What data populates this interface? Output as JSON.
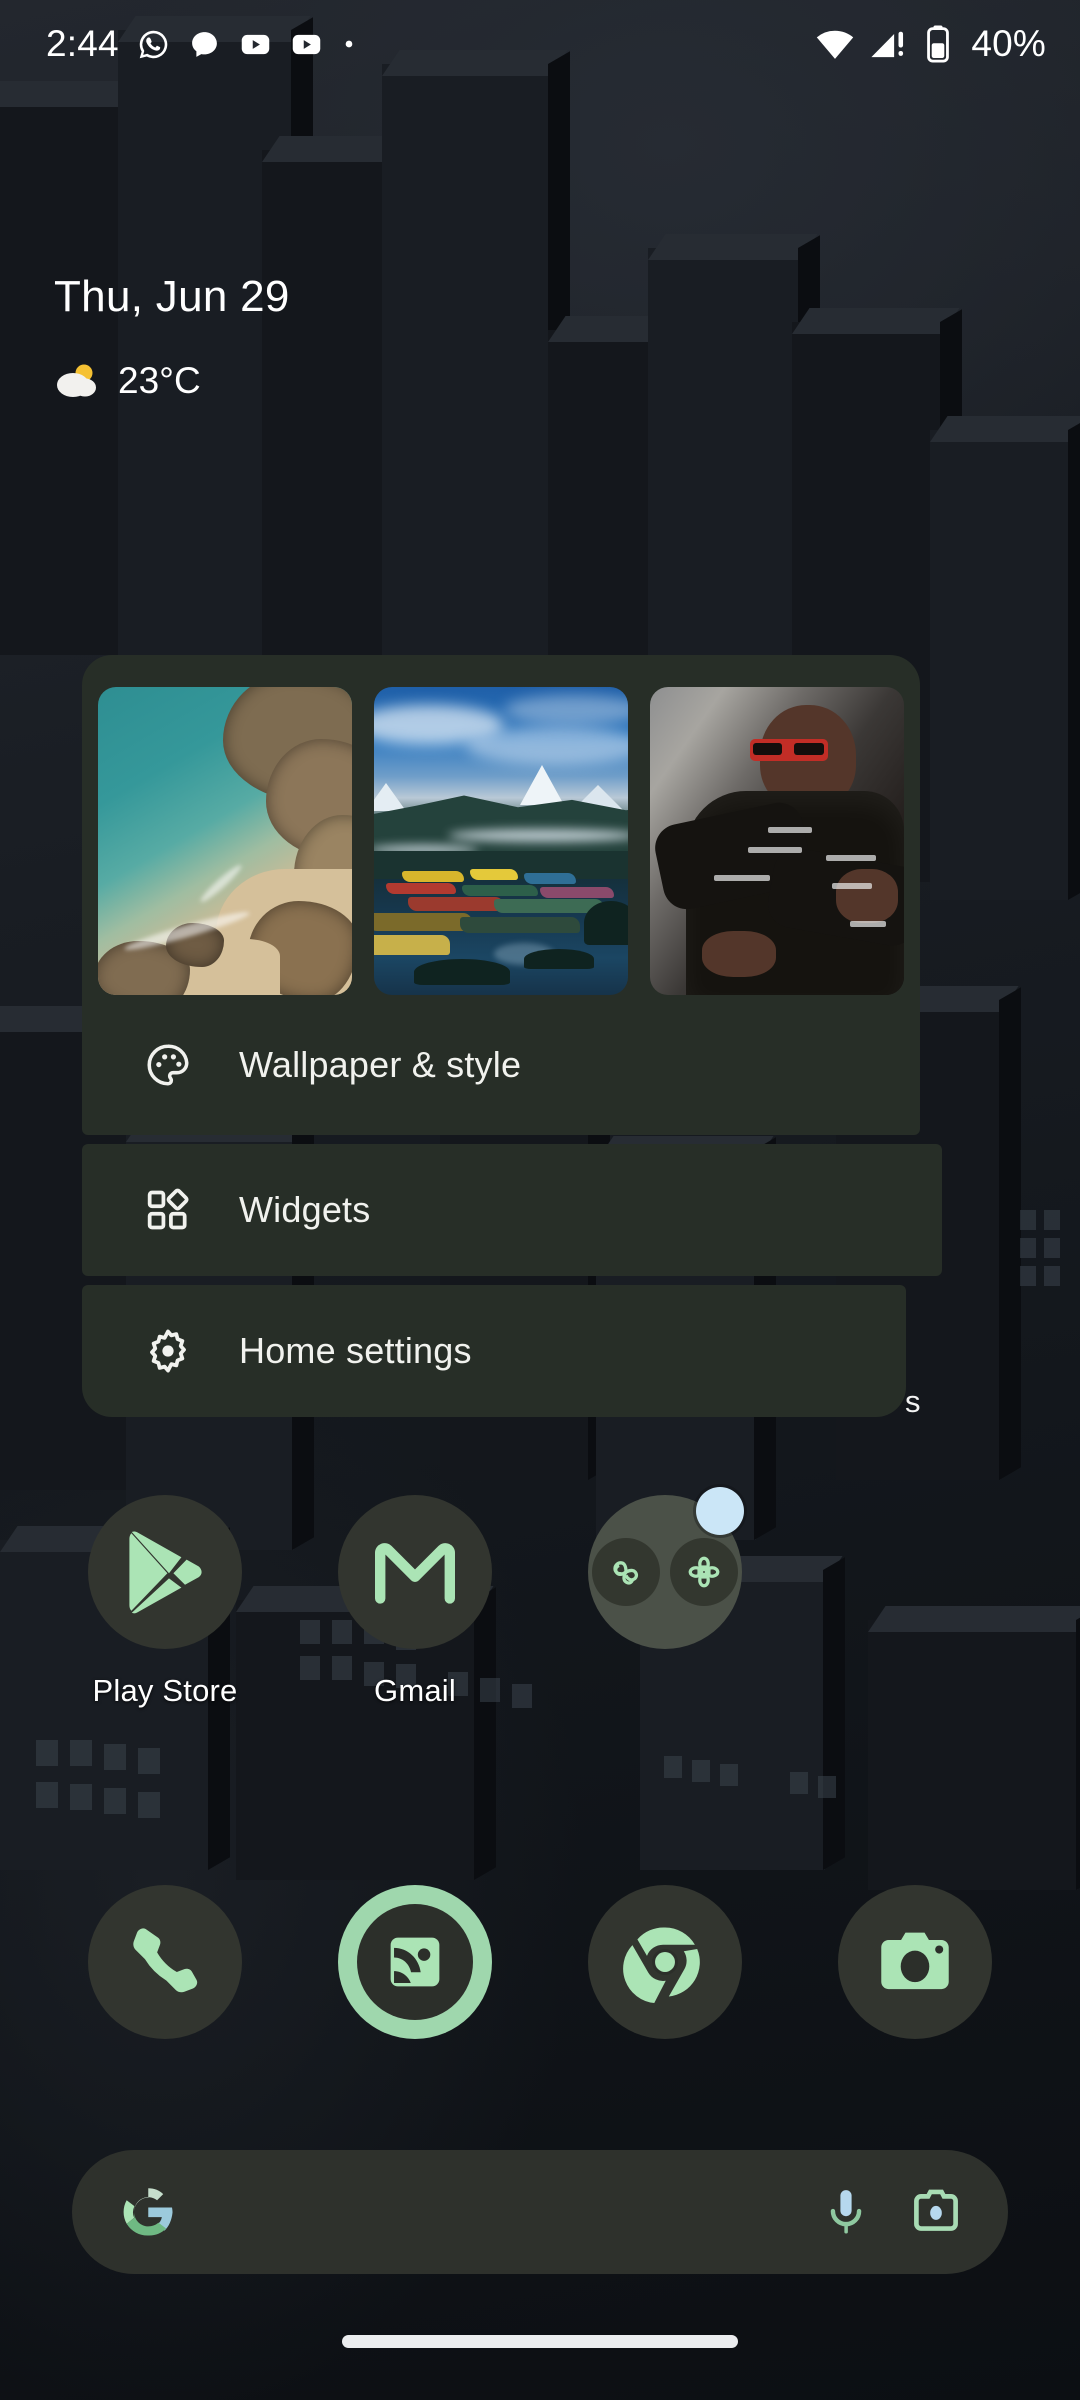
{
  "status_bar": {
    "time": "2:44",
    "battery_percent": "40%",
    "left_icons": [
      "whatsapp-icon",
      "messages-icon",
      "youtube-icon",
      "youtube-icon",
      "overflow-dot-icon"
    ],
    "right_icons": [
      "wifi-icon",
      "cellular-signal-alert-icon",
      "battery-icon"
    ]
  },
  "smartspace": {
    "date": "Thu, Jun 29",
    "temperature": "23°C",
    "weather_icon": "partly-cloudy-icon"
  },
  "popup_menu": {
    "wallpaper_card": {
      "label": "Wallpaper & style",
      "icon": "palette-icon",
      "thumbnails": [
        {
          "name": "aerial-coast-wallpaper",
          "description": "Aerial view of turquoise sea, sandy beach and rocky cliffs"
        },
        {
          "name": "mountain-lake-wallpaper",
          "description": "Snow-capped mountains over a lake with colourful wooden boats"
        },
        {
          "name": "f1-driver-wallpaper",
          "description": "Formula 1 driver in black racing suit wearing red sunglasses"
        }
      ]
    },
    "widgets": {
      "label": "Widgets",
      "icon": "widgets-icon"
    },
    "home_settings": {
      "label": "Home settings",
      "icon": "gear-icon"
    },
    "obscured_app_label": "s"
  },
  "apps": [
    {
      "label": "Play Store",
      "icon": "play-store-icon"
    },
    {
      "label": "Gmail",
      "icon": "gmail-icon"
    },
    {
      "label": "",
      "icon": "app-folder-icon",
      "badge": true
    },
    {
      "label": "",
      "icon": ""
    }
  ],
  "dock": [
    {
      "label": "Phone",
      "icon": "phone-icon",
      "highlighted": false
    },
    {
      "label": "Photos",
      "icon": "photos-icon",
      "highlighted": true
    },
    {
      "label": "Chrome",
      "icon": "chrome-icon",
      "highlighted": false
    },
    {
      "label": "Camera",
      "icon": "camera-icon",
      "highlighted": false
    }
  ],
  "search_bar": {
    "logo_icon": "google-g-icon",
    "mic_icon": "microphone-icon",
    "lens_icon": "google-lens-icon",
    "query": ""
  },
  "navigation": {
    "gesture_pill": true
  },
  "colors": {
    "accent_mint": "#abe4b5",
    "menu_card": "#272e27",
    "icon_circle": "#32352f",
    "badge_blue": "#cbe6f7",
    "text_primary": "#ffffff"
  }
}
